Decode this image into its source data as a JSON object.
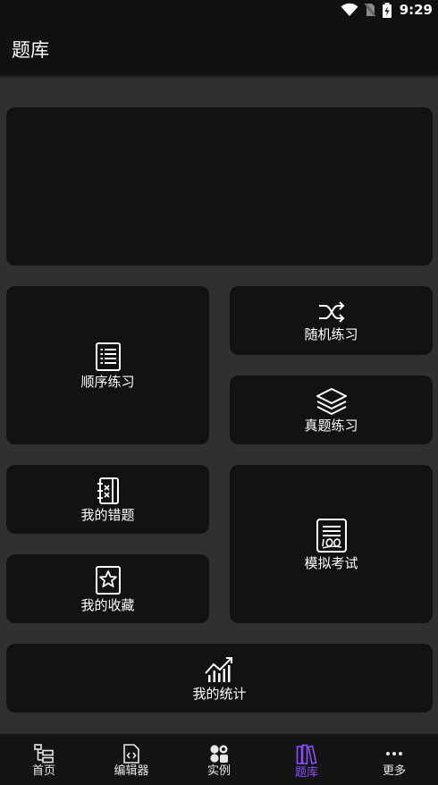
{
  "status_bar": {
    "time": "9:29",
    "icons": [
      "wifi-icon",
      "no-sim-icon",
      "battery-charging-icon"
    ]
  },
  "app_bar": {
    "title": "题库"
  },
  "banner": {
    "label": ""
  },
  "cards": {
    "sequential": {
      "label": "顺序练习",
      "icon": "list-document-icon"
    },
    "random": {
      "label": "随机练习",
      "icon": "shuffle-icon"
    },
    "real_exam": {
      "label": "真题练习",
      "icon": "layers-icon"
    },
    "mistakes": {
      "label": "我的错题",
      "icon": "notebook-x-icon"
    },
    "favorites": {
      "label": "我的收藏",
      "icon": "star-bookmark-icon"
    },
    "mock_exam": {
      "label": "模拟考试",
      "icon": "exam-score-icon"
    },
    "statistics": {
      "label": "我的统计",
      "icon": "chart-trend-icon"
    }
  },
  "bottom_nav": {
    "items": [
      {
        "label": "首页",
        "icon": "tree-structure-icon",
        "active": false
      },
      {
        "label": "编辑器",
        "icon": "code-file-icon",
        "active": false
      },
      {
        "label": "实例",
        "icon": "grid-shapes-icon",
        "active": false
      },
      {
        "label": "题库",
        "icon": "books-icon",
        "active": true
      },
      {
        "label": "更多",
        "icon": "more-dots-icon",
        "active": false
      }
    ]
  },
  "colors": {
    "background": "#303030",
    "card": "#121212",
    "bar": "#111111",
    "accent": "#8a4fff",
    "text": "#ffffff"
  }
}
